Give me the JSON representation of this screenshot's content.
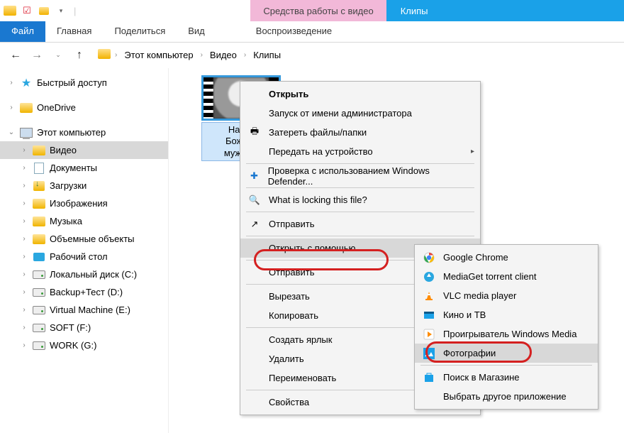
{
  "titlebar": {
    "context_tab": "Средства работы с видео",
    "window_title": "Клипы"
  },
  "ribbon": {
    "file": "Файл",
    "tabs": [
      "Главная",
      "Поделиться",
      "Вид"
    ],
    "context_tab": "Воспроизведение"
  },
  "breadcrumb": {
    "items": [
      "Этот компьютер",
      "Видео",
      "Клипы"
    ]
  },
  "nav_tree": {
    "quick_access": "Быстрый доступ",
    "onedrive": "OneDrive",
    "this_pc": "Этот компьютер",
    "children": [
      {
        "label": "Видео",
        "selected": true
      },
      {
        "label": "Документы"
      },
      {
        "label": "Загрузки"
      },
      {
        "label": "Изображения"
      },
      {
        "label": "Музыка"
      },
      {
        "label": "Объемные объекты"
      },
      {
        "label": "Рабочий стол"
      },
      {
        "label": "Локальный диск (C:)"
      },
      {
        "label": "Backup+Тест (D:)"
      },
      {
        "label": "Virtual Machine (E:)"
      },
      {
        "label": "SOFT (F:)"
      },
      {
        "label": "WORK (G:)"
      }
    ]
  },
  "file": {
    "name_line1": "Натали",
    "name_line2": "Боже, ка",
    "name_line3": "мужчина!"
  },
  "context_menu": {
    "open": "Открыть",
    "run_as_admin": "Запуск от имени администратора",
    "wipe": "Затереть файлы/папки",
    "cast": "Передать на устройство",
    "defender": "Проверка с использованием Windows Defender...",
    "what_lock": "What is locking this file?",
    "send_to": "Отправить",
    "open_with": "Открыть с помощью",
    "send_to2": "Отправить",
    "cut": "Вырезать",
    "copy": "Копировать",
    "shortcut": "Создать ярлык",
    "delete": "Удалить",
    "rename": "Переименовать",
    "properties": "Свойства"
  },
  "open_with_menu": {
    "items": [
      {
        "label": "Google Chrome",
        "icon": "chrome-icon"
      },
      {
        "label": "MediaGet torrent client",
        "icon": "mediaget-icon"
      },
      {
        "label": "VLC media player",
        "icon": "vlc-icon"
      },
      {
        "label": "Кино и ТВ",
        "icon": "movies-tv-icon"
      },
      {
        "label": "Проигрыватель Windows Media",
        "icon": "wmp-icon"
      },
      {
        "label": "Фотографии",
        "icon": "photos-icon",
        "highlighted": true
      }
    ],
    "store": "Поиск в Магазине",
    "choose_other": "Выбрать другое приложение"
  }
}
